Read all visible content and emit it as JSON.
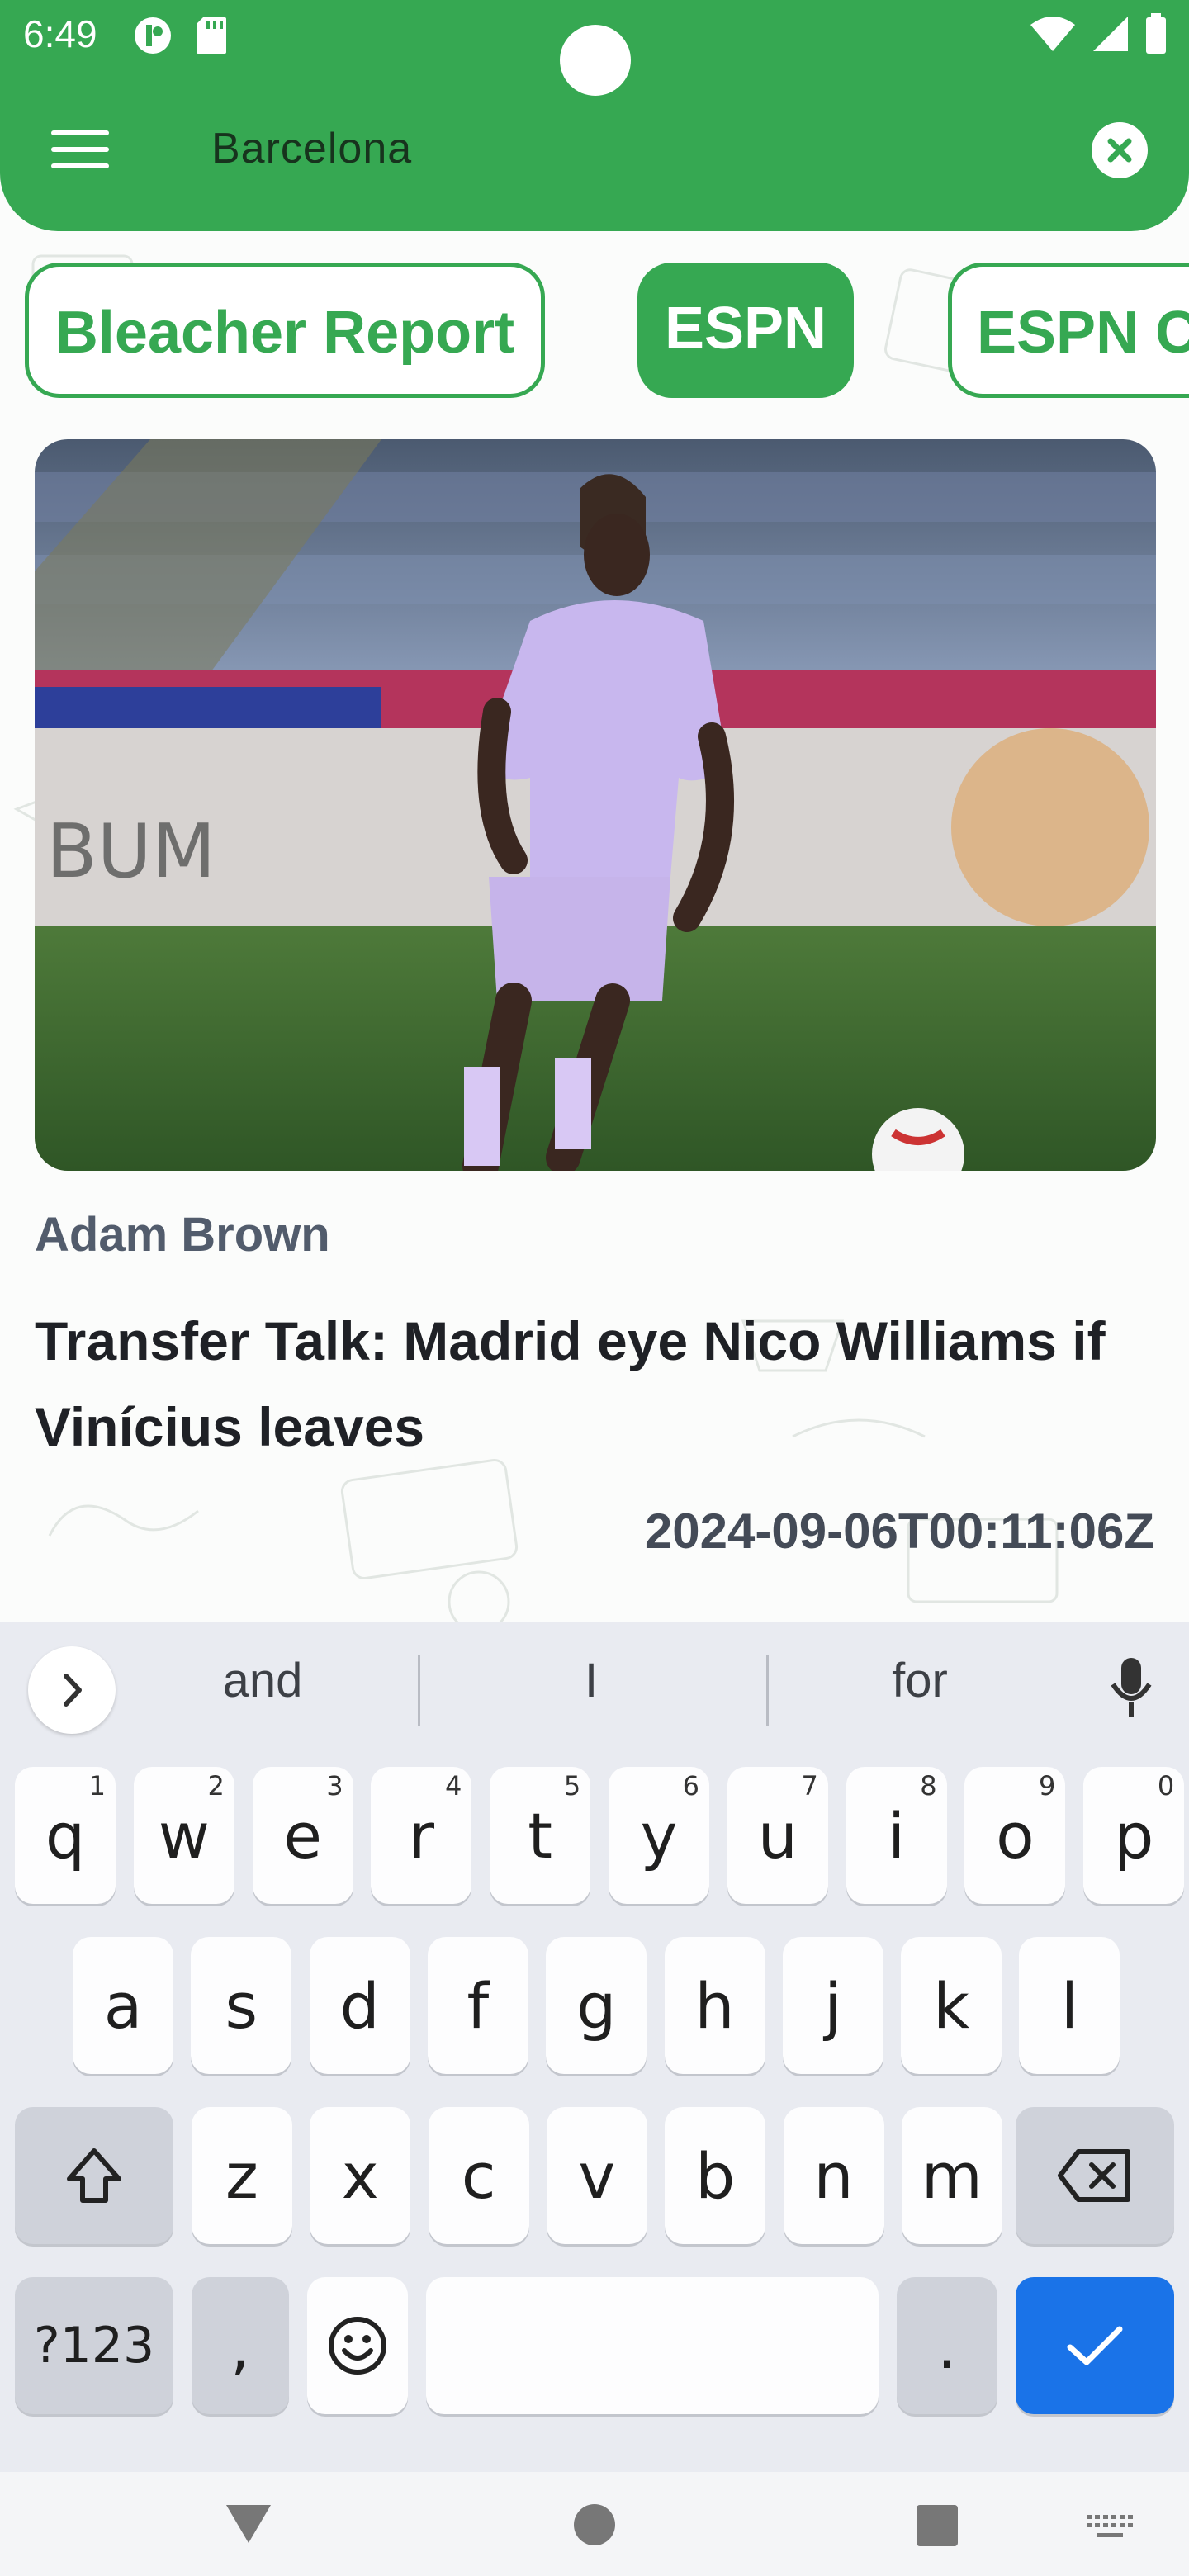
{
  "status_bar": {
    "time": "6:49"
  },
  "search": {
    "query": "Barcelona"
  },
  "sources": [
    {
      "label": "Bleacher Report",
      "selected": false
    },
    {
      "label": "ESPN",
      "selected": true
    },
    {
      "label": "ESPN C",
      "selected": false
    }
  ],
  "article": {
    "author": "Adam Brown",
    "title": "Transfer Talk: Madrid eye Nico Williams if Vinícius leaves",
    "date": "2024-09-06T00:11:06Z",
    "image_icon": "football-player-photo"
  },
  "keyboard": {
    "suggestions": [
      "and",
      "I",
      "for"
    ],
    "row1": [
      {
        "k": "q",
        "n": "1"
      },
      {
        "k": "w",
        "n": "2"
      },
      {
        "k": "e",
        "n": "3"
      },
      {
        "k": "r",
        "n": "4"
      },
      {
        "k": "t",
        "n": "5"
      },
      {
        "k": "y",
        "n": "6"
      },
      {
        "k": "u",
        "n": "7"
      },
      {
        "k": "i",
        "n": "8"
      },
      {
        "k": "o",
        "n": "9"
      },
      {
        "k": "p",
        "n": "0"
      }
    ],
    "row2": [
      "a",
      "s",
      "d",
      "f",
      "g",
      "h",
      "j",
      "k",
      "l"
    ],
    "row3": [
      "z",
      "x",
      "c",
      "v",
      "b",
      "n",
      "m"
    ],
    "symbols_label": "?123",
    "comma": ",",
    "period": "."
  },
  "colors": {
    "brand_green": "#36a852",
    "enter_blue": "#1a73e8"
  }
}
